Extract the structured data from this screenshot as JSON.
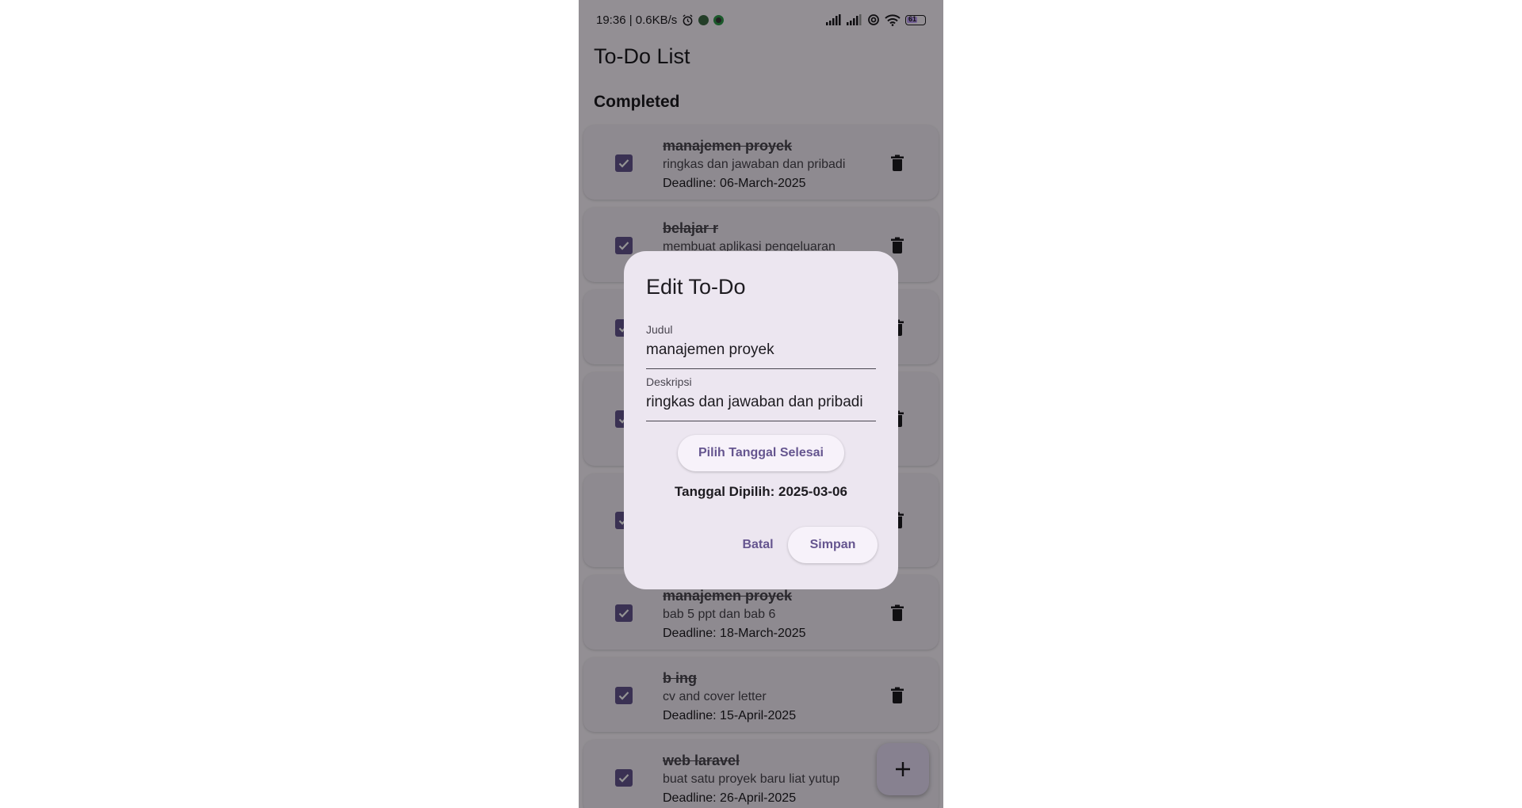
{
  "status_bar": {
    "time_speed": "19:36 | 0.6KB/s",
    "battery": "61"
  },
  "app": {
    "title": "To-Do List",
    "section": "Completed"
  },
  "tasks": [
    {
      "title": "manajemen proyek",
      "description": "ringkas dan jawaban dan pribadi",
      "deadline": "Deadline: 06-March-2025",
      "completed": true
    },
    {
      "title": "belajar r",
      "description": "membuat aplikasi pengeluaran",
      "deadline": "",
      "completed": true
    },
    {
      "title": "",
      "description": "",
      "deadline": "",
      "completed": true
    },
    {
      "title": "",
      "description": "",
      "deadline": "",
      "completed": true
    },
    {
      "title": "",
      "description": "",
      "deadline": "",
      "completed": true
    },
    {
      "title": "manajemen proyek",
      "description": "bab 5 ppt dan bab 6",
      "deadline": "Deadline: 18-March-2025",
      "completed": true
    },
    {
      "title": "b ing",
      "description": "cv and cover letter",
      "deadline": "Deadline: 15-April-2025",
      "completed": true
    },
    {
      "title": "web laravel",
      "description": "buat satu proyek baru liat yutup",
      "deadline": "Deadline: 26-April-2025",
      "completed": true
    }
  ],
  "dialog": {
    "title": "Edit To-Do",
    "title_field": {
      "label": "Judul",
      "value": "manajemen proyek"
    },
    "desc_field": {
      "label": "Deskripsi",
      "value": "ringkas dan jawaban dan pribadi"
    },
    "pick_date_label": "Pilih Tanggal Selesai",
    "selected_date": "Tanggal Dipilih: 2025-03-06",
    "cancel_label": "Batal",
    "save_label": "Simpan"
  },
  "colors": {
    "accent": "#65558f",
    "surface": "#fdf7ff",
    "card": "#f4eef8",
    "dialog": "#ece6f0",
    "fab": "#e8def8"
  },
  "icons": [
    "alarm-icon",
    "location-icon",
    "app-notification-icon",
    "signal-icon",
    "hotspot-icon",
    "wifi-icon",
    "battery-icon",
    "check-icon",
    "trash-icon",
    "plus-icon"
  ]
}
